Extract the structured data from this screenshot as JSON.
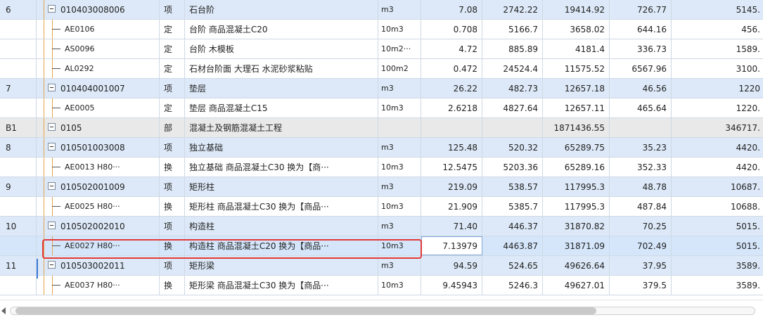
{
  "rows": [
    {
      "no": "6",
      "code": "010403008006",
      "kind": "项",
      "name": "石台阶",
      "unit": "m3",
      "qty": "7.08",
      "price": "2742.22",
      "total": "19414.92",
      "c8": "726.77",
      "c9": "5145.",
      "type": "item"
    },
    {
      "no": "",
      "code": "AE0106",
      "kind": "定",
      "name": "台阶 商品混凝土C20",
      "unit": "10m3",
      "qty": "0.708",
      "price": "5166.7",
      "total": "3658.02",
      "c8": "644.16",
      "c9": "456.",
      "type": "quota"
    },
    {
      "no": "",
      "code": "AS0096",
      "kind": "定",
      "name": "台阶 木模板",
      "unit": "10m2···",
      "qty": "4.72",
      "price": "885.89",
      "total": "4181.4",
      "c8": "336.73",
      "c9": "1589.",
      "type": "quota"
    },
    {
      "no": "",
      "code": "AL0292",
      "kind": "定",
      "name": "石材台阶面 大理石 水泥砂浆粘贴",
      "unit": "100m2",
      "qty": "0.472",
      "price": "24524.4",
      "total": "11575.52",
      "c8": "6567.96",
      "c9": "3100.",
      "type": "quota"
    },
    {
      "no": "7",
      "code": "010404001007",
      "kind": "项",
      "name": "垫层",
      "unit": "m3",
      "qty": "26.22",
      "price": "482.73",
      "total": "12657.18",
      "c8": "46.56",
      "c9": "1220",
      "type": "item"
    },
    {
      "no": "",
      "code": "AE0005",
      "kind": "定",
      "name": "垫层 商品混凝土C15",
      "unit": "10m3",
      "qty": "2.6218",
      "price": "4827.64",
      "total": "12657.11",
      "c8": "465.64",
      "c9": "1220.",
      "type": "quota"
    },
    {
      "no": "B1",
      "code": "0105",
      "kind": "部",
      "name": "混凝土及钢筋混凝土工程",
      "unit": "",
      "qty": "",
      "price": "",
      "total": "1871436.55",
      "c8": "",
      "c9": "346717.",
      "type": "section"
    },
    {
      "no": "8",
      "code": "010501003008",
      "kind": "项",
      "name": "独立基础",
      "unit": "m3",
      "qty": "125.48",
      "price": "520.32",
      "total": "65289.75",
      "c8": "35.23",
      "c9": "4420.",
      "type": "item"
    },
    {
      "no": "",
      "code": "AE0013 H80···",
      "kind": "换",
      "name": "独立基础 商品混凝土C30  换为【商···",
      "unit": "10m3",
      "qty": "12.5475",
      "price": "5203.36",
      "total": "65289.16",
      "c8": "352.33",
      "c9": "4420.",
      "type": "quota"
    },
    {
      "no": "9",
      "code": "010502001009",
      "kind": "项",
      "name": "矩形柱",
      "unit": "m3",
      "qty": "219.09",
      "price": "538.57",
      "total": "117995.3",
      "c8": "48.78",
      "c9": "10687.",
      "type": "item"
    },
    {
      "no": "",
      "code": "AE0025 H80···",
      "kind": "换",
      "name": "矩形柱 商品混凝土C30  换为【商品···",
      "unit": "10m3",
      "qty": "21.909",
      "price": "5385.7",
      "total": "117995.3",
      "c8": "487.84",
      "c9": "10688.",
      "type": "quota"
    },
    {
      "no": "10",
      "code": "010502002010",
      "kind": "项",
      "name": "构造柱",
      "unit": "m3",
      "qty": "71.40",
      "price": "446.37",
      "total": "31870.82",
      "c8": "70.25",
      "c9": "5015.",
      "type": "item"
    },
    {
      "no": "",
      "code": "AE0027 H80···",
      "kind": "换",
      "name": "构造柱 商品混凝土C20  换为【商品···",
      "unit": "10m3",
      "qty": "7.13979",
      "price": "4463.87",
      "total": "31871.09",
      "c8": "702.49",
      "c9": "5015.",
      "type": "selected"
    },
    {
      "no": "11",
      "code": "010503002011",
      "kind": "项",
      "name": "矩形梁",
      "unit": "m3",
      "qty": "94.59",
      "price": "524.65",
      "total": "49626.64",
      "c8": "37.95",
      "c9": "3589.",
      "type": "item"
    },
    {
      "no": "",
      "code": "AE0037 H80···",
      "kind": "换",
      "name": "矩形梁 商品混凝土C30  换为【商品···",
      "unit": "10m3",
      "qty": "9.45943",
      "price": "5246.3",
      "total": "49627.01",
      "c8": "379.5",
      "c9": "3589.",
      "type": "quota"
    }
  ],
  "icons": {
    "expand": "collapse-minus-icon",
    "scroll_left": "scroll-left-arrow-icon"
  },
  "colors": {
    "item_row": "#dde9f8",
    "section_row": "#e9e9e9",
    "highlight": "#e13a3a",
    "tree_line": "#e2a54a"
  }
}
